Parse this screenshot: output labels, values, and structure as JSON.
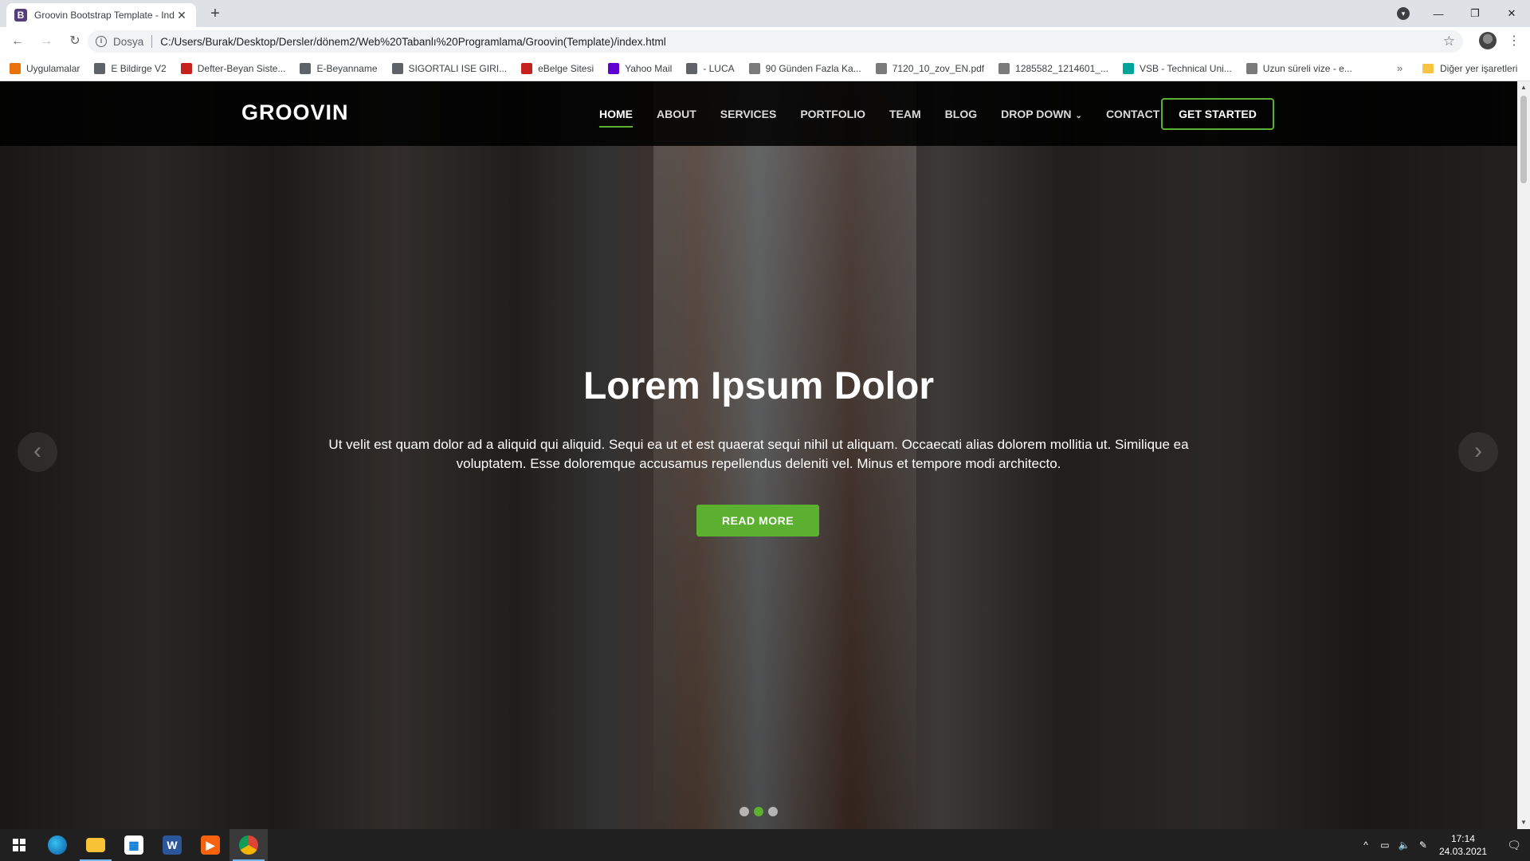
{
  "browser": {
    "tab_title": "Groovin Bootstrap Template - Ind",
    "tab_favicon": "B",
    "newtab": "+",
    "address_scheme": "Dosya",
    "address_url": "C:/Users/Burak/Desktop/Dersler/dönem2/Web%20Tabanlı%20Programlama/Groovin(Template)/index.html",
    "bookmarks": [
      {
        "label": "Uygulamalar",
        "icon": "apps-grid-icon",
        "color": "#e8710a"
      },
      {
        "label": "E Bildirge V2",
        "icon": "globe-icon",
        "color": "#5f6368"
      },
      {
        "label": "Defter-Beyan Siste...",
        "icon": "document-icon",
        "color": "#c5221f"
      },
      {
        "label": "E-Beyanname",
        "icon": "globe-icon",
        "color": "#5f6368"
      },
      {
        "label": "SIGORTALI ISE GIRI...",
        "icon": "globe-icon",
        "color": "#5f6368"
      },
      {
        "label": "eBelge Sitesi",
        "icon": "document-icon",
        "color": "#c5221f"
      },
      {
        "label": "Yahoo Mail",
        "icon": "mail-icon",
        "color": "#6001d2"
      },
      {
        "label": "- LUCA",
        "icon": "luca-icon",
        "color": "#5f6368"
      },
      {
        "label": "90 Günden Fazla Ka...",
        "icon": "seal-icon",
        "color": "#7a7a7a"
      },
      {
        "label": "7120_10_zov_EN.pdf",
        "icon": "seal-icon",
        "color": "#7a7a7a"
      },
      {
        "label": "1285582_1214601_...",
        "icon": "seal-icon",
        "color": "#7a7a7a"
      },
      {
        "label": "VSB - Technical Uni...",
        "icon": "vsb-icon",
        "color": "#00a499"
      },
      {
        "label": "Uzun süreli vize - e...",
        "icon": "seal-icon",
        "color": "#7a7a7a"
      }
    ],
    "bookmarks_more": "»",
    "other_bookmarks": "Diğer yer işaretleri"
  },
  "site": {
    "logo": "GROOVIN",
    "nav": [
      {
        "label": "HOME",
        "active": true
      },
      {
        "label": "ABOUT"
      },
      {
        "label": "SERVICES"
      },
      {
        "label": "PORTFOLIO"
      },
      {
        "label": "TEAM"
      },
      {
        "label": "BLOG"
      },
      {
        "label": "DROP DOWN"
      },
      {
        "label": "CONTACT"
      }
    ],
    "cta": "GET STARTED",
    "accent_color": "#5bb12f"
  },
  "hero": {
    "title": "Lorem Ipsum Dolor",
    "text": "Ut velit est quam dolor ad a aliquid qui aliquid. Sequi ea ut et est quaerat sequi nihil ut aliquam. Occaecati alias dolorem mollitia ut. Similique ea voluptatem. Esse doloremque accusamus repellendus deleniti vel. Minus et tempore modi architecto.",
    "button": "READ MORE",
    "prev_icon": "‹",
    "next_icon": "›",
    "active_slide": 2,
    "slide_count": 3
  },
  "taskbar": {
    "apps": [
      "edge-icon",
      "file-explorer-icon",
      "store-icon",
      "word-icon",
      "media-player-icon",
      "chrome-icon"
    ],
    "time": "17:14",
    "date": "24.03.2021"
  }
}
